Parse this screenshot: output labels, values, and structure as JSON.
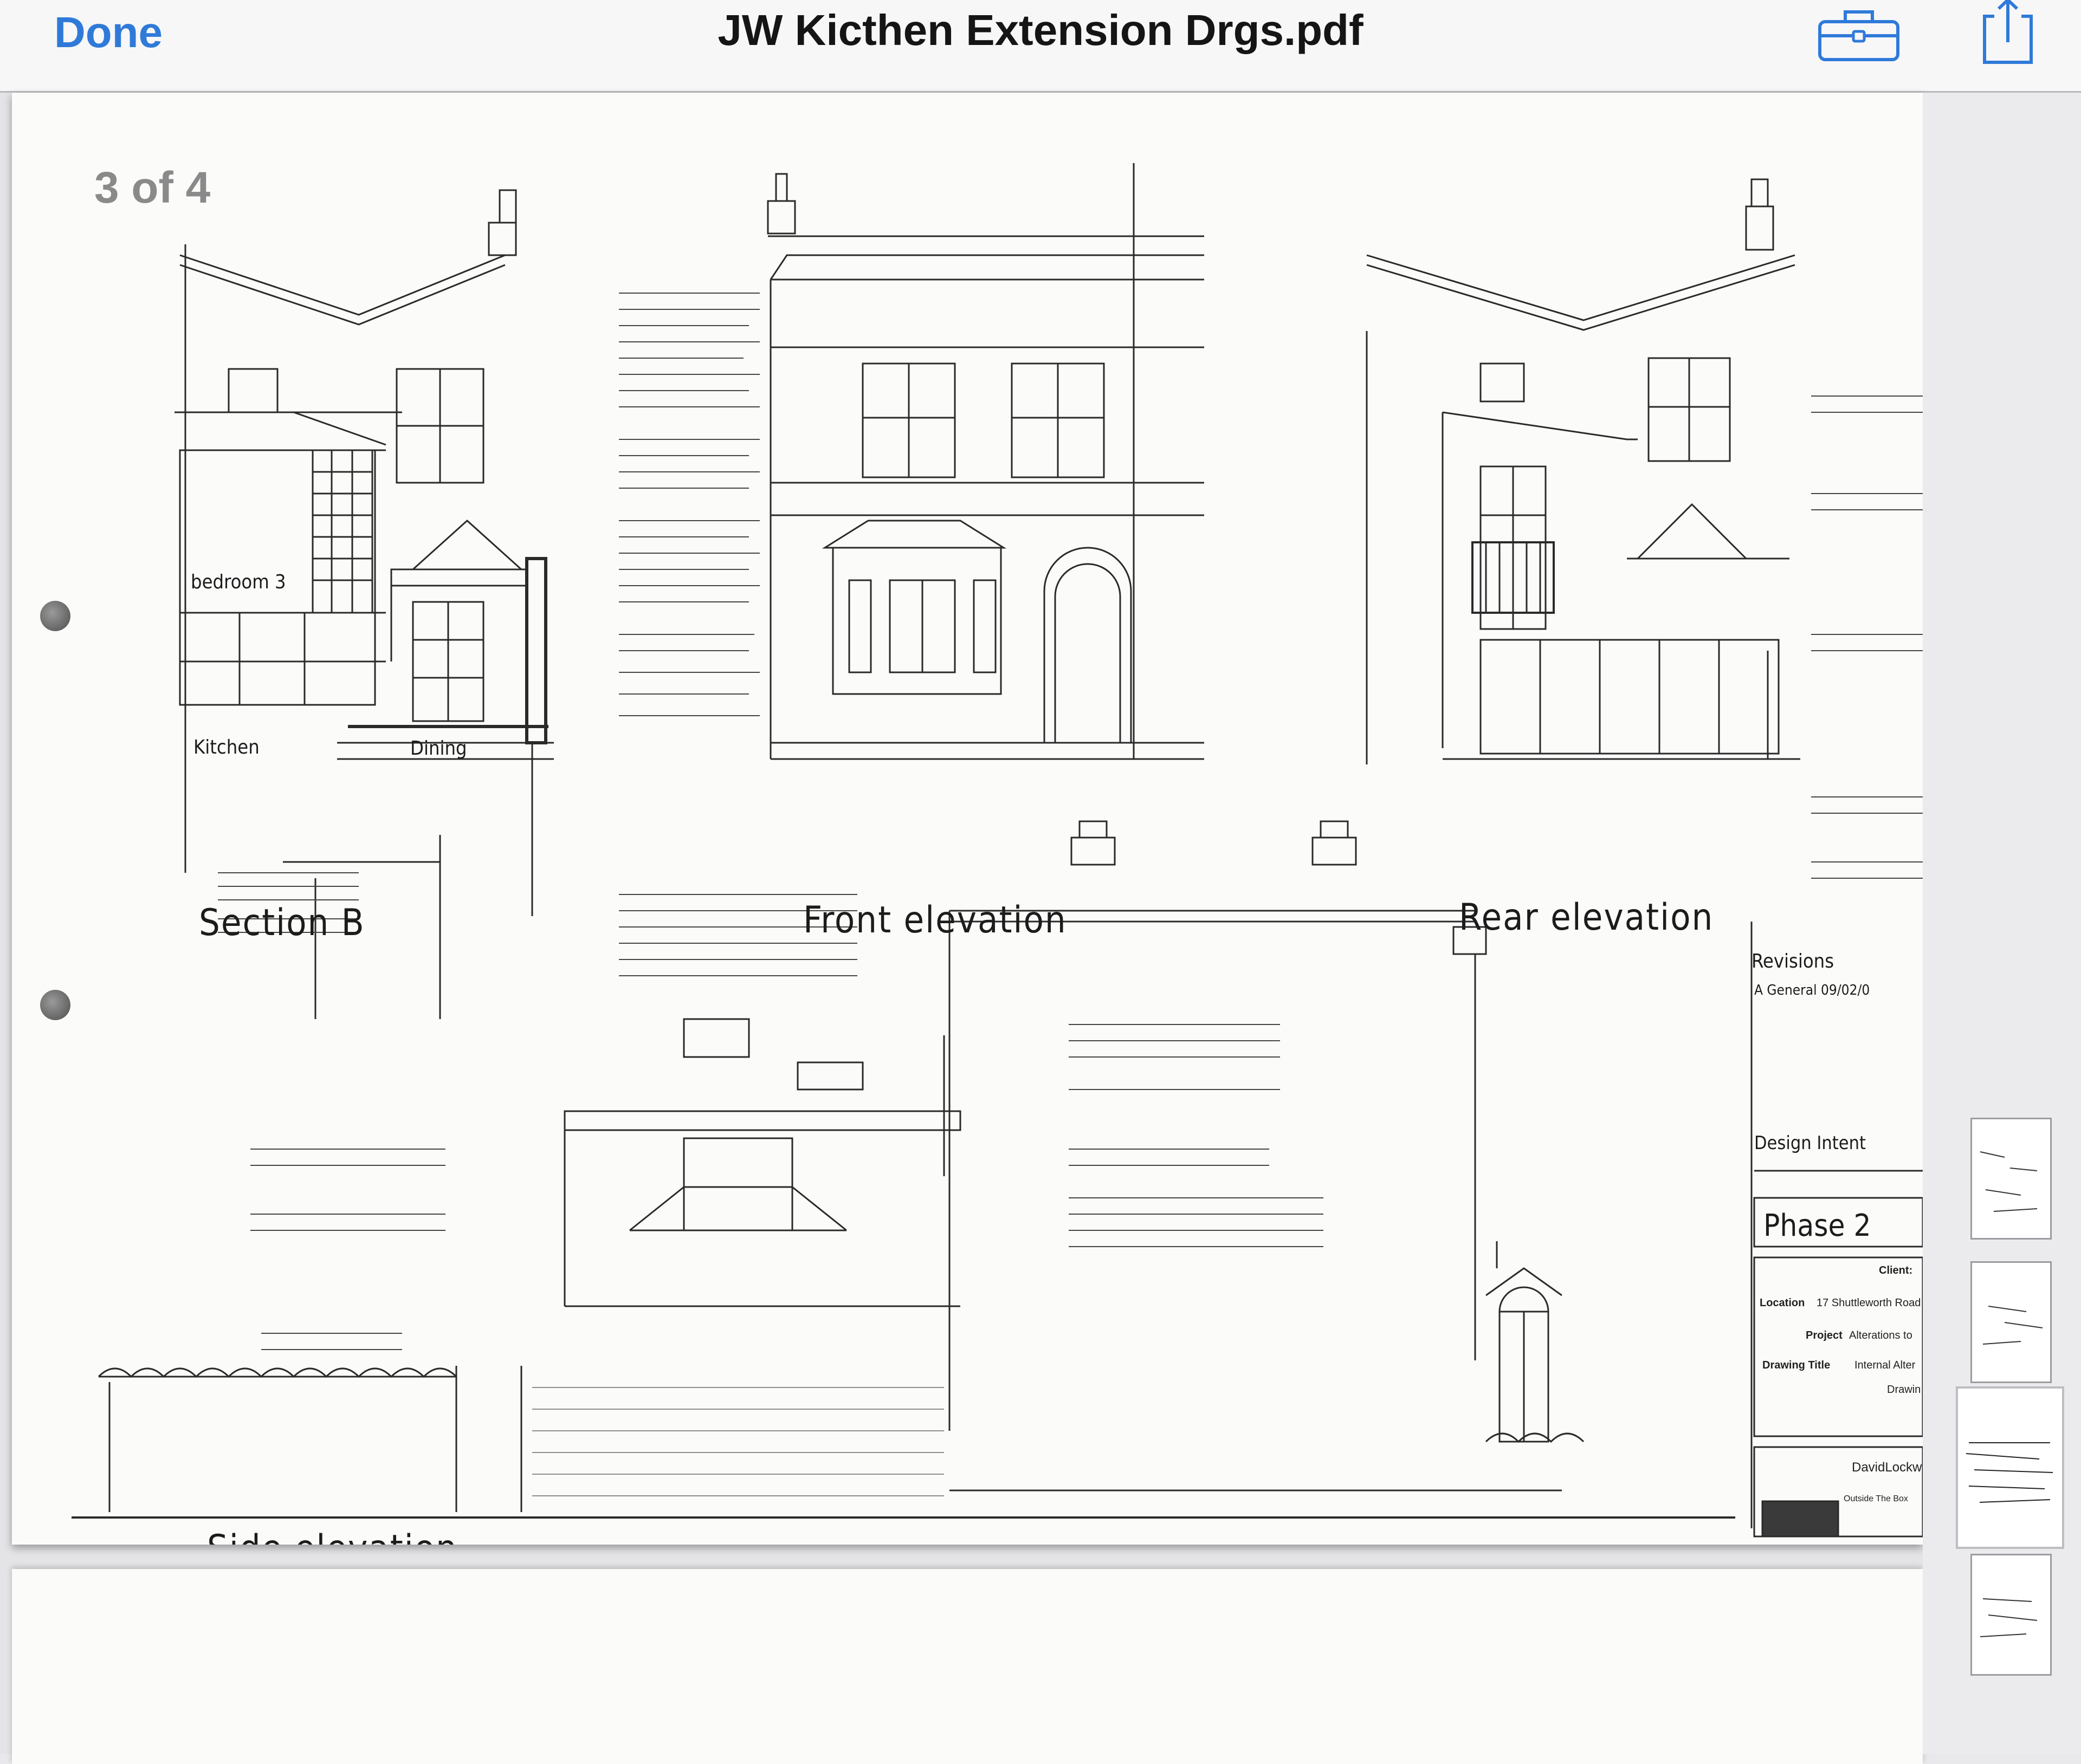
{
  "navbar": {
    "done_label": "Done",
    "title": "JW Kicthen Extension Drgs.pdf",
    "toolbox_icon": "toolbox-icon",
    "share_icon": "share-icon",
    "accent_color": "#2f7ad9"
  },
  "document": {
    "page_indicator": "3 of 4",
    "drawing_labels": {
      "section_b": "Section  B",
      "front_elevation": "Front  elevation",
      "rear_elevation": "Rear  elevation",
      "side_elevation": "Side  elevation",
      "bedroom": "bedroom  3",
      "kitchen": "Kitchen",
      "dining": "Dining"
    },
    "title_block": {
      "revisions": "Revisions",
      "revision_a": "A   General     09/02/0",
      "design_intent": "Design Intent",
      "phase": "Phase   2",
      "client": "Client:",
      "location": "Location",
      "location_value": "17 Shuttleworth Road",
      "project": "Project",
      "project_value": "Alterations to",
      "drawing_title": "Drawing  Title",
      "drawing_title_value": "Internal Alter",
      "drawing_label": "Drawin",
      "firm": "DavidLockw",
      "firm_sub": "Outside The Box"
    }
  },
  "thumbnails": {
    "pages": [
      {
        "label": "page 1",
        "selected": false
      },
      {
        "label": "page 2",
        "selected": false
      },
      {
        "label": "page 3",
        "selected": true
      },
      {
        "label": "page 4",
        "selected": false
      }
    ]
  }
}
